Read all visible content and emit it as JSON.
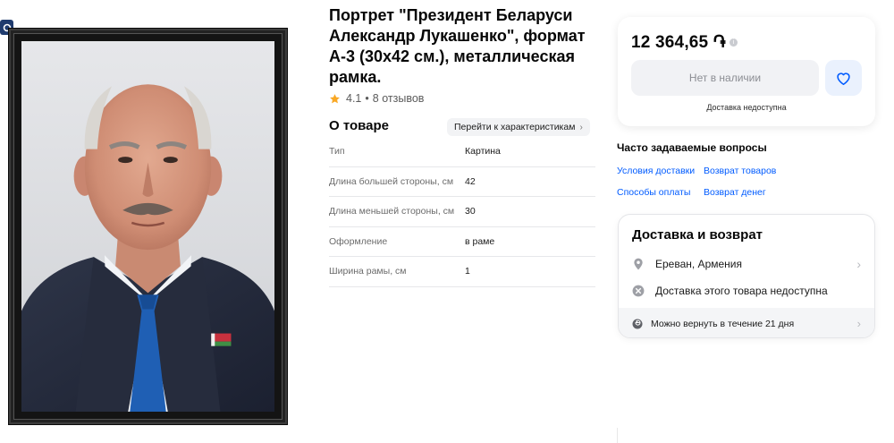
{
  "product": {
    "title": "Портрет \"Президент Беларуси Александр Лукашенко\", формат А-3 (30х42 см.), металлическая рамка.",
    "rating": "4.1",
    "rating_separator": "•",
    "reviews": "8 отзывов"
  },
  "about": {
    "title": "О товаре",
    "specs_link": "Перейти к характеристикам",
    "specs": [
      {
        "name": "Тип",
        "value": "Картина"
      },
      {
        "name": "Длина большей стороны, см",
        "value": "42"
      },
      {
        "name": "Длина меньшей стороны, см",
        "value": "30"
      },
      {
        "name": "Оформление",
        "value": "в раме"
      },
      {
        "name": "Ширина рамы, см",
        "value": "1"
      }
    ]
  },
  "price_card": {
    "price": "12 364,65 ֏",
    "info_icon": "i",
    "unavailable_button": "Нет в наличии",
    "delivery_note": "Доставка недоступна"
  },
  "faq": {
    "title": "Часто задаваемые вопросы",
    "links": [
      "Условия доставки",
      "Возврат товаров",
      "Способы оплаты",
      "Возврат денег"
    ]
  },
  "delivery": {
    "title": "Доставка и возврат",
    "location": "Ереван, Армения",
    "status": "Доставка этого товара недоступна",
    "return_policy": "Можно вернуть в течение 21 дня"
  },
  "colors": {
    "link": "#005bff",
    "rating_star": "#f9a825",
    "favorite_bg": "#eaf1fd",
    "favorite_icon": "#005bff"
  },
  "icons": {
    "zoom": "zoom-icon",
    "star": "star-icon",
    "favorite": "heart-icon",
    "location": "location-pin-icon",
    "unavailable": "close-circle-icon",
    "return": "return-icon",
    "chevron": "chevron-right-icon"
  }
}
